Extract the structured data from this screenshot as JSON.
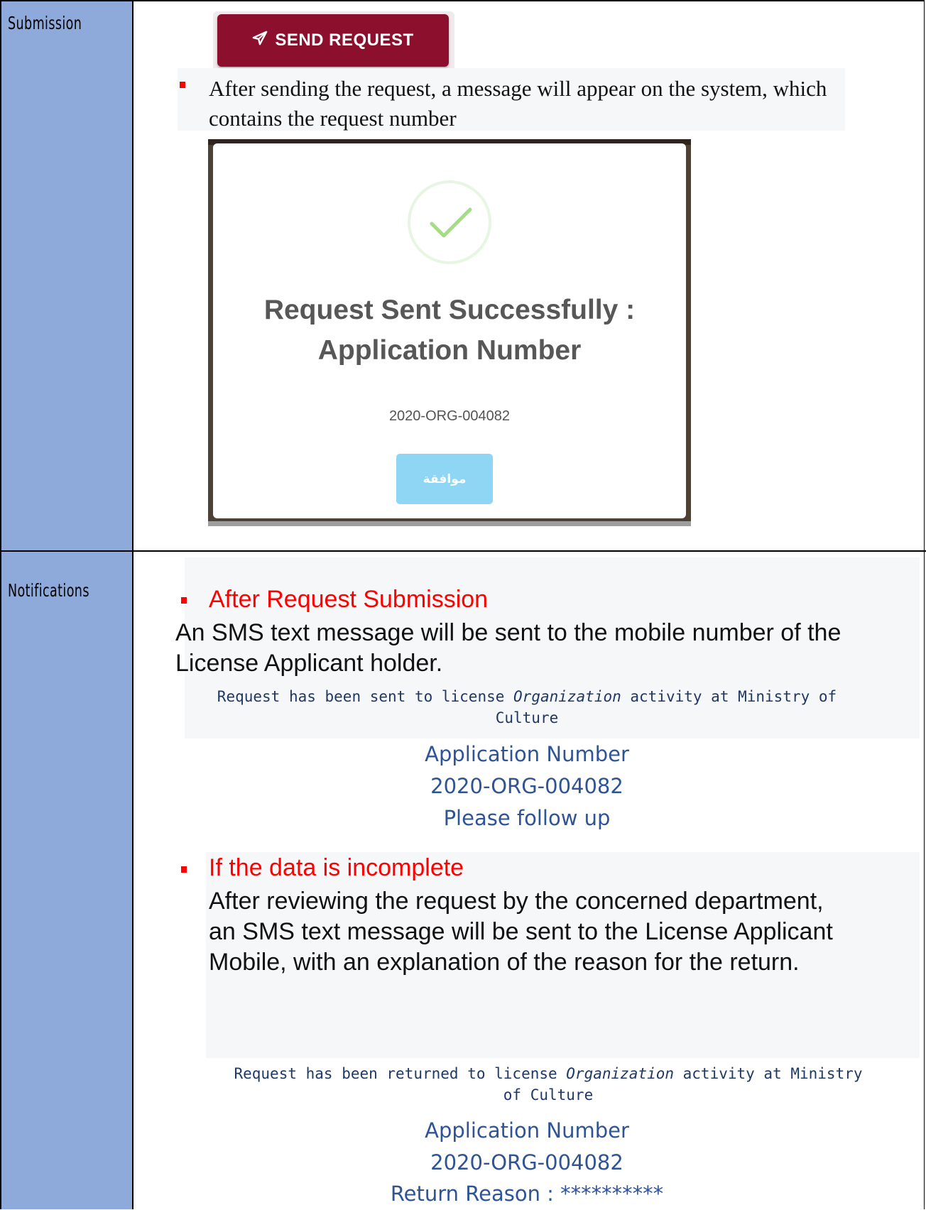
{
  "rows": [
    {
      "label": "Submission"
    },
    {
      "label": "Notifications"
    }
  ],
  "submission": {
    "send_button_label": "SEND REQUEST",
    "send_icon": "paper-plane-icon",
    "note_line1": "After sending the request, a message will appear on the system, which",
    "note_line2": "contains the request number",
    "modal": {
      "title_line1": "Request Sent Successfully :",
      "title_line2": "Application Number",
      "application_number": "2020-ORG-004082",
      "ok_label": "موافقة",
      "check_icon": "success-check-icon"
    }
  },
  "notifications": {
    "section1": {
      "heading": "After Request Submission",
      "body_line1": "An SMS text message will be sent to the mobile number of the",
      "body_line2": "License Applicant holder.",
      "sms_line1_pre": "Request has been sent to license ",
      "sms_line1_italic": "Organization",
      "sms_line1_post": " activity at Ministry of",
      "sms_line2": "Culture",
      "app_label": "Application Number",
      "app_number": "2020-ORG-004082",
      "footer": "Please follow up"
    },
    "section2": {
      "heading": "If the data is incomplete",
      "body_line1": "After reviewing the request by the concerned department,",
      "body_line2": "an SMS text message will be sent to the License Applicant",
      "body_line3": "Mobile, with an explanation of the reason for the return.",
      "sms_line1_pre": "Request has been returned to license ",
      "sms_line1_italic": "Organization",
      "sms_line1_post": " activity at Ministry",
      "sms_line2": "of Culture",
      "app_label": "Application Number",
      "app_number": "2020-ORG-004082",
      "footer": "Return Reason : **********"
    }
  },
  "colors": {
    "label_bg": "#8eaadb",
    "send_button": "#8c0f2e",
    "heading_red": "#ff0000",
    "sms_blue": "#2f5496",
    "ok_button": "#8fd5f4"
  }
}
